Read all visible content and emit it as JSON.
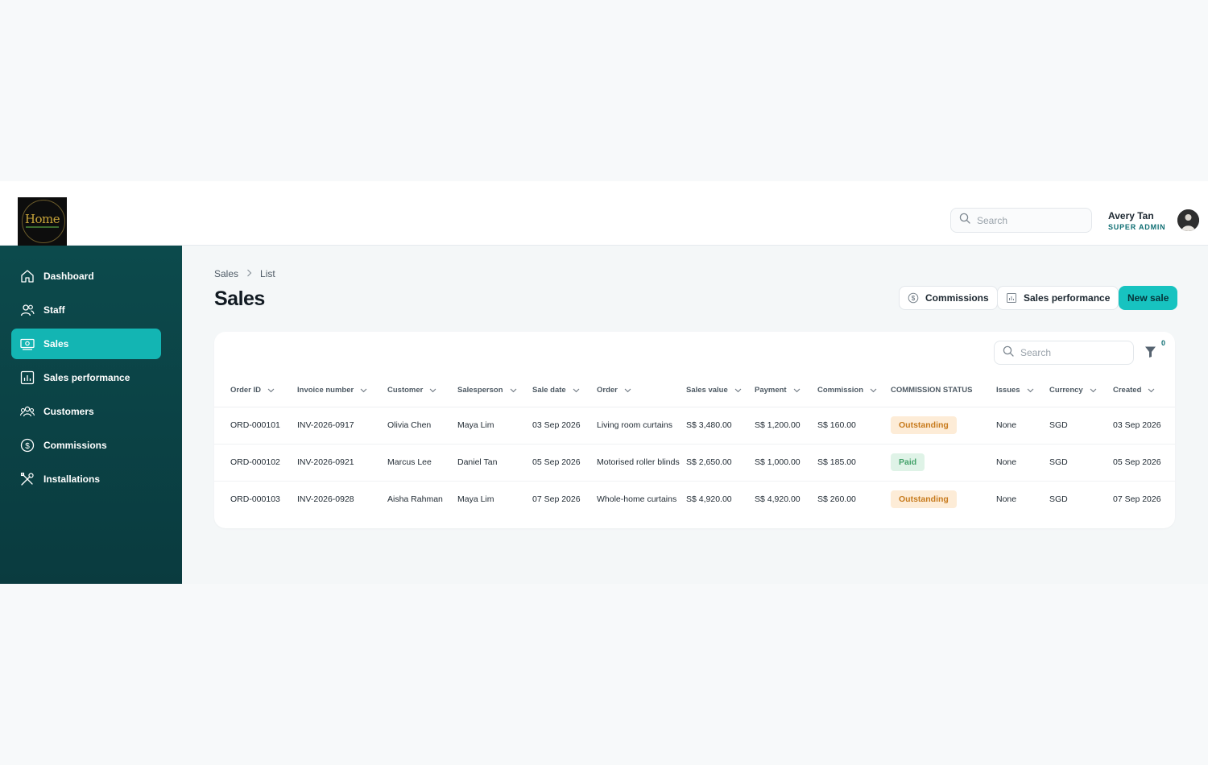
{
  "topbar": {
    "logo_text": "Home",
    "search_placeholder": "Search",
    "user_name": "Avery Tan",
    "user_role": "SUPER ADMIN"
  },
  "sidebar": {
    "items": [
      {
        "label": "Dashboard",
        "icon": "home-icon",
        "active": false
      },
      {
        "label": "Staff",
        "icon": "users-icon",
        "active": false
      },
      {
        "label": "Sales",
        "icon": "cash-icon",
        "active": true
      },
      {
        "label": "Sales performance",
        "icon": "bar-chart-icon",
        "active": false
      },
      {
        "label": "Customers",
        "icon": "customers-icon",
        "active": false
      },
      {
        "label": "Commissions",
        "icon": "dollar-circle-icon",
        "active": false
      },
      {
        "label": "Installations",
        "icon": "tools-icon",
        "active": false
      }
    ]
  },
  "page": {
    "breadcrumb": [
      "Sales",
      "List"
    ],
    "title": "Sales",
    "actions": {
      "commissions": "Commissions",
      "sales_performance": "Sales performance",
      "new_sale": "New sale"
    }
  },
  "table": {
    "search_placeholder": "Search",
    "filter_count": "0",
    "columns": [
      "Order ID",
      "Invoice number",
      "Customer",
      "Salesperson",
      "Sale date",
      "Order",
      "Sales value",
      "Payment",
      "Commission",
      "COMMISSION STATUS",
      "Issues",
      "Currency",
      "Created"
    ],
    "sortable": [
      true,
      true,
      true,
      true,
      true,
      true,
      true,
      true,
      true,
      false,
      true,
      true,
      true
    ],
    "rows": [
      [
        "ORD-000101",
        "INV-2026-0917",
        "Olivia Chen",
        "Maya Lim",
        "03 Sep 2026",
        "Living room curtains",
        "S$ 3,480.00",
        "S$ 1,200.00",
        "S$ 160.00",
        "Outstanding",
        "None",
        "SGD",
        "03 Sep 2026"
      ],
      [
        "ORD-000102",
        "INV-2026-0921",
        "Marcus Lee",
        "Daniel Tan",
        "05 Sep 2026",
        "Motorised roller blinds",
        "S$ 2,650.00",
        "S$ 1,000.00",
        "S$ 185.00",
        "Paid",
        "None",
        "SGD",
        "05 Sep 2026"
      ],
      [
        "ORD-000103",
        "INV-2026-0928",
        "Aisha Rahman",
        "Maya Lim",
        "07 Sep 2026",
        "Whole-home curtains",
        "S$ 4,920.00",
        "S$ 4,920.00",
        "S$ 260.00",
        "Outstanding",
        "None",
        "SGD",
        "07 Sep 2026"
      ]
    ]
  },
  "colors": {
    "sidebar_bg": "#0c4a4c",
    "accent": "#17c3c0",
    "outstanding_bg": "#fdecd7",
    "outstanding_fg": "#c77a1c",
    "paid_bg": "#dff3e7",
    "paid_fg": "#43a26a"
  }
}
